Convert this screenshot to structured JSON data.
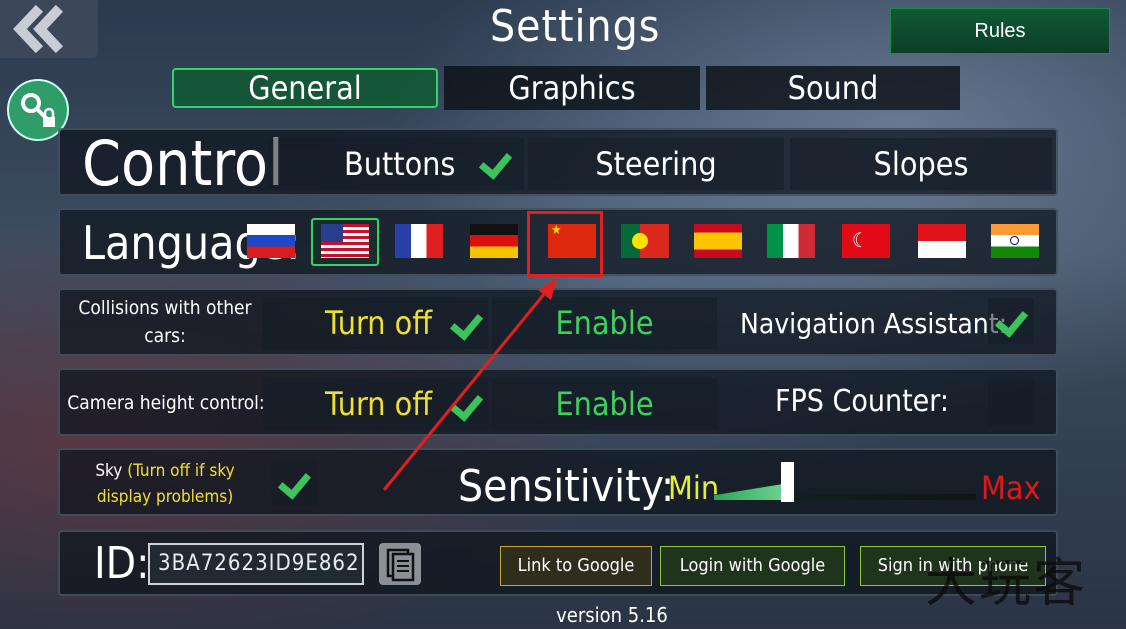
{
  "header": {
    "title": "Settings",
    "rules_label": "Rules"
  },
  "tabs": [
    {
      "label": "General",
      "active": true
    },
    {
      "label": "Graphics",
      "active": false
    },
    {
      "label": "Sound",
      "active": false
    }
  ],
  "control": {
    "title": "Control",
    "options": [
      {
        "label": "Buttons",
        "checked": true
      },
      {
        "label": "Steering",
        "checked": false
      },
      {
        "label": "Slopes",
        "checked": false
      }
    ]
  },
  "language": {
    "label": "Language:",
    "selected": "usa-flag",
    "flags": [
      "russia-flag",
      "usa-flag",
      "france-flag",
      "germany-flag",
      "china-flag",
      "portugal-flag",
      "spain-flag",
      "italy-flag",
      "turkey-flag",
      "indonesia-flag",
      "india-flag"
    ]
  },
  "collisions": {
    "label": "Collisions with other cars:",
    "turn_off": "Turn off",
    "enable": "Enable",
    "selected": "turn_off"
  },
  "nav_assistant": {
    "label": "Navigation Assistant:",
    "checked": true
  },
  "camera": {
    "label": "Camera height control:",
    "turn_off": "Turn off",
    "enable": "Enable",
    "selected": "turn_off"
  },
  "fps": {
    "label": "FPS Counter:",
    "checked": false
  },
  "sky": {
    "label": "Sky",
    "note": "(Turn off if sky display problems)",
    "checked": true
  },
  "sensitivity": {
    "label": "Sensitivity:",
    "min_label": "Min",
    "max_label": "Max",
    "value": 0.27
  },
  "account": {
    "id_label": "ID:",
    "id_value": "3BA72623ID9E862",
    "link_google": "Link to Google",
    "login_google": "Login with Google",
    "sign_in_phone": "Sign in with phone"
  },
  "version": "version 5.16",
  "watermark": "大玩客",
  "colors": {
    "green_accent": "#3cc35c",
    "yellow_text": "#f0e030",
    "red_text": "#e01818",
    "annotation_red": "#e02020"
  }
}
